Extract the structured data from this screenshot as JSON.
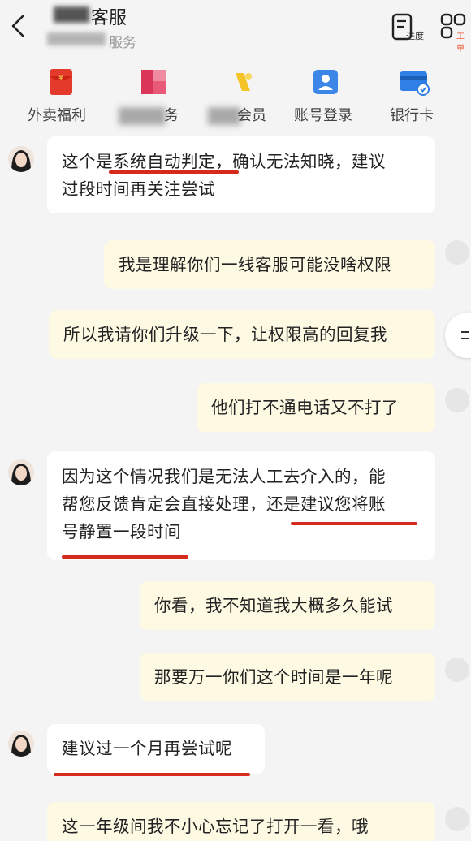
{
  "header": {
    "title_suffix": "客服",
    "subtitle_suffix": "服务",
    "progress_label": "进度",
    "tool_label": "工单"
  },
  "services": [
    {
      "label": "外卖福利",
      "icon": "red-envelope-icon",
      "color": "#e33a2c"
    },
    {
      "label": "",
      "icon": "colorful-app-icon",
      "color": "#d9365a",
      "blurred": true
    },
    {
      "label": "",
      "icon": "yellow-app-icon",
      "color": "#f4c325",
      "blurred": true
    },
    {
      "label": "账号登录",
      "icon": "account-login-icon",
      "color": "#3c86e8"
    },
    {
      "label": "银行卡",
      "icon": "bank-card-icon",
      "color": "#2f7fe6"
    }
  ],
  "partial_labels": {
    "svc2": "务",
    "svc3": "会员"
  },
  "messages": [
    {
      "from": "agent",
      "lines": [
        "这个是系统自动判定，确认无法知晓，建议",
        "过段时间再关注尝试"
      ]
    },
    {
      "from": "user",
      "lines": [
        "我是理解你们一线客服可能没啥权限"
      ]
    },
    {
      "from": "user",
      "lines": [
        "所以我请你们升级一下，让权限高的回复我"
      ]
    },
    {
      "from": "user",
      "lines": [
        "他们打不通电话又不打了"
      ]
    },
    {
      "from": "agent",
      "lines": [
        "因为这个情况我们是无法人工去介入的，能",
        "帮您反馈肯定会直接处理，还是建议您将账",
        "号静置一段时间"
      ]
    },
    {
      "from": "user",
      "lines": [
        "你看，我不知道我大概多久能试"
      ]
    },
    {
      "from": "user",
      "lines": [
        "那要万一你们这个时间是一年呢"
      ]
    },
    {
      "from": "agent",
      "lines": [
        "建议过一个月再尝试呢"
      ]
    },
    {
      "from": "user",
      "lines": [
        "这一年级间我不小心忘记了打开一看，哦"
      ]
    }
  ],
  "colors": {
    "bubble_agent": "#ffffff",
    "bubble_user": "#fdf9e3",
    "underline": "#d62a1e"
  }
}
